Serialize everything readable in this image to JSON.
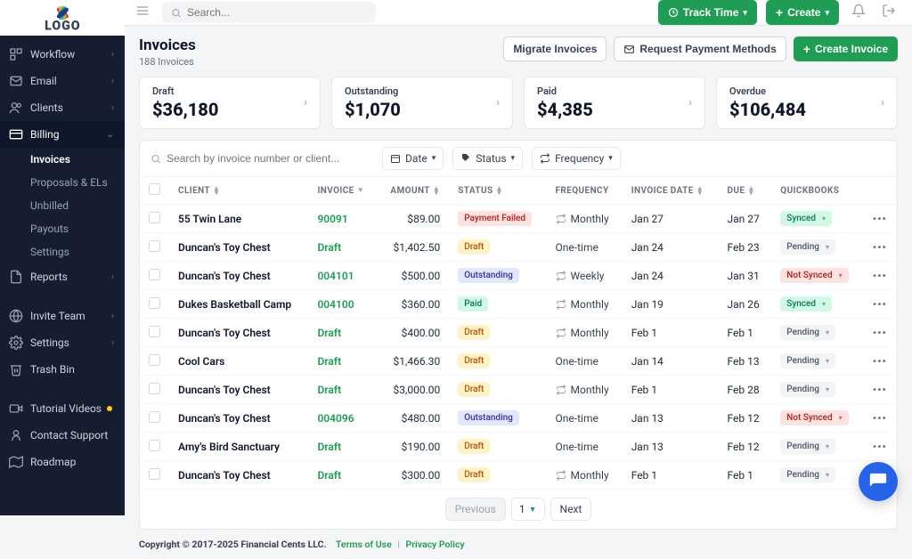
{
  "brand": {
    "name": "LOGO"
  },
  "topbar": {
    "search_placeholder": "Search...",
    "track_time": "Track Time",
    "create": "Create"
  },
  "sidebar": {
    "items": [
      {
        "label": "Workflow",
        "icon": "workflow"
      },
      {
        "label": "Email",
        "icon": "mail"
      },
      {
        "label": "Clients",
        "icon": "users"
      },
      {
        "label": "Billing",
        "icon": "card",
        "active": true
      },
      {
        "label": "Reports",
        "icon": "report"
      },
      {
        "label": "Invite Team",
        "icon": "globe"
      },
      {
        "label": "Settings",
        "icon": "gear"
      },
      {
        "label": "Trash Bin",
        "icon": "trash"
      },
      {
        "label": "Tutorial Videos",
        "icon": "video"
      },
      {
        "label": "Contact Support",
        "icon": "support"
      },
      {
        "label": "Roadmap",
        "icon": "map"
      }
    ],
    "billing_sub": [
      {
        "label": "Invoices",
        "selected": true
      },
      {
        "label": "Proposals & ELs"
      },
      {
        "label": "Unbilled"
      },
      {
        "label": "Payouts"
      },
      {
        "label": "Settings"
      }
    ]
  },
  "page": {
    "title": "Invoices",
    "subtitle": "188 Invoices",
    "migrate_label": "Migrate Invoices",
    "request_payment_label": "Request Payment Methods",
    "create_invoice_label": "Create Invoice"
  },
  "stats": [
    {
      "label": "Draft",
      "value": "$36,180"
    },
    {
      "label": "Outstanding",
      "value": "$1,070"
    },
    {
      "label": "Paid",
      "value": "$4,385"
    },
    {
      "label": "Overdue",
      "value": "$106,484"
    }
  ],
  "filters": {
    "search_placeholder": "Search by invoice number or client...",
    "date": "Date",
    "status": "Status",
    "frequency": "Frequency"
  },
  "columns": {
    "client": "CLIENT",
    "invoice": "INVOICE",
    "amount": "AMOUNT",
    "status": "STATUS",
    "frequency": "FREQUENCY",
    "invoice_date": "INVOICE DATE",
    "due": "DUE",
    "quickbooks": "QUICKBOOKS"
  },
  "rows": [
    {
      "client": "55 Twin Lane",
      "invoice": "90091",
      "amount": "$89.00",
      "status": "Payment Failed",
      "status_class": "payment-failed",
      "frequency": "Monthly",
      "recurring": true,
      "invoice_date": "Jan 27",
      "due": "Jan 27",
      "qb": "Synced",
      "qb_class": "synced"
    },
    {
      "client": "Duncan's Toy Chest",
      "invoice": "Draft",
      "amount": "$1,402.50",
      "status": "Draft",
      "status_class": "draft",
      "frequency": "One-time",
      "recurring": false,
      "invoice_date": "Jan 24",
      "due": "Feb 23",
      "qb": "Pending",
      "qb_class": "pending"
    },
    {
      "client": "Duncan's Toy Chest",
      "invoice": "004101",
      "amount": "$500.00",
      "status": "Outstanding",
      "status_class": "outstanding",
      "frequency": "Weekly",
      "recurring": true,
      "invoice_date": "Jan 24",
      "due": "Jan 31",
      "qb": "Not Synced",
      "qb_class": "not-synced"
    },
    {
      "client": "Dukes Basketball Camp",
      "invoice": "004100",
      "amount": "$360.00",
      "status": "Paid",
      "status_class": "paid",
      "frequency": "Monthly",
      "recurring": true,
      "invoice_date": "Jan 19",
      "due": "Jan 26",
      "qb": "Synced",
      "qb_class": "synced"
    },
    {
      "client": "Duncan's Toy Chest",
      "invoice": "Draft",
      "amount": "$400.00",
      "status": "Draft",
      "status_class": "draft",
      "frequency": "Monthly",
      "recurring": true,
      "invoice_date": "Feb 1",
      "due": "Feb 1",
      "qb": "Pending",
      "qb_class": "pending"
    },
    {
      "client": "Cool Cars",
      "invoice": "Draft",
      "amount": "$1,466.30",
      "status": "Draft",
      "status_class": "draft",
      "frequency": "One-time",
      "recurring": false,
      "invoice_date": "Jan 14",
      "due": "Feb 13",
      "qb": "Pending",
      "qb_class": "pending"
    },
    {
      "client": "Duncan's Toy Chest",
      "invoice": "Draft",
      "amount": "$3,000.00",
      "status": "Draft",
      "status_class": "draft",
      "frequency": "Monthly",
      "recurring": true,
      "invoice_date": "Feb 1",
      "due": "Feb 28",
      "qb": "Pending",
      "qb_class": "pending"
    },
    {
      "client": "Duncan's Toy Chest",
      "invoice": "004096",
      "amount": "$480.00",
      "status": "Outstanding",
      "status_class": "outstanding",
      "frequency": "One-time",
      "recurring": false,
      "invoice_date": "Jan 13",
      "due": "Feb 12",
      "qb": "Not Synced",
      "qb_class": "not-synced"
    },
    {
      "client": "Amy's Bird Sanctuary",
      "invoice": "Draft",
      "amount": "$190.00",
      "status": "Draft",
      "status_class": "draft",
      "frequency": "One-time",
      "recurring": false,
      "invoice_date": "Jan 13",
      "due": "Feb 12",
      "qb": "Pending",
      "qb_class": "pending"
    },
    {
      "client": "Duncan's Toy Chest",
      "invoice": "Draft",
      "amount": "$300.00",
      "status": "Draft",
      "status_class": "draft",
      "frequency": "Monthly",
      "recurring": true,
      "invoice_date": "Feb 1",
      "due": "Feb 1",
      "qb": "Pending",
      "qb_class": "pending"
    }
  ],
  "pagination": {
    "previous": "Previous",
    "next": "Next",
    "page": "1"
  },
  "footer": {
    "copyright": "Copyright © 2017-2025 Financial Cents LLC.",
    "terms": "Terms of Use",
    "privacy": "Privacy Policy"
  }
}
